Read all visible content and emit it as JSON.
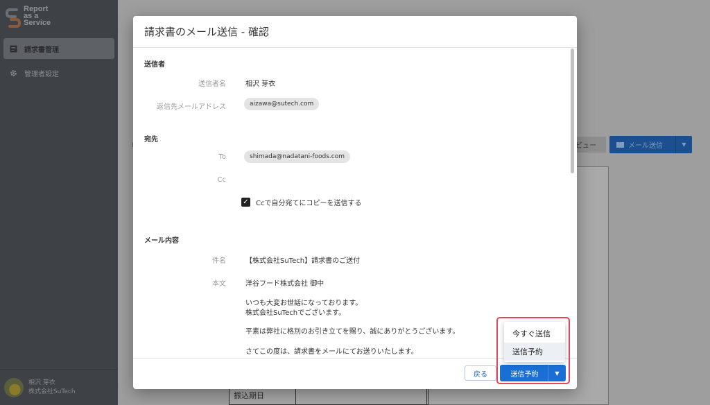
{
  "app": {
    "logo_lines": [
      "Report",
      "as a",
      "Service"
    ]
  },
  "sidebar": {
    "items": [
      {
        "label": "請求書管理",
        "icon": "document-icon",
        "active": true
      },
      {
        "label": "管理者設定",
        "icon": "gear-icon",
        "active": false
      }
    ],
    "user": {
      "name": "相沢 芽衣",
      "company": "株式会社SuTech"
    }
  },
  "background": {
    "preview_label": "ビュー",
    "send_label": "メール送信",
    "doc_cell": "振込期日"
  },
  "modal": {
    "title": "請求書のメール送信 - 確認",
    "sender": {
      "section": "送信者",
      "name_label": "送信者名",
      "name_value": "相沢 芽衣",
      "reply_label": "返信先メールアドレス",
      "reply_value": "aizawa@sutech.com"
    },
    "recipient": {
      "section": "宛先",
      "to_label": "To",
      "to_value": "shimada@nadatani-foods.com",
      "cc_label": "Cc",
      "cc_self_label": "Ccで自分宛てにコピーを送信する",
      "cc_self_checked": true
    },
    "content": {
      "section": "メール内容",
      "subject_label": "件名",
      "subject_value": "【株式会社SuTech】請求書のご送付",
      "body_label": "本文",
      "body_lines": [
        "洋谷フード株式会社 御中",
        "いつも大変お世話になっております。",
        "株式会社SuTechでございます。",
        "平素は弊社に格別のお引き立てを賜り、誠にありがとうございます。",
        "さてこの度は、請求書をメールにてお送りいたします。"
      ]
    },
    "footer": {
      "back_label": "戻る",
      "schedule_label": "送信予約"
    }
  },
  "dropdown": {
    "items": [
      "今すぐ送信",
      "送信予約"
    ],
    "highlighted": "送信予約"
  },
  "colors": {
    "primary": "#1a6fd6",
    "annotation": "#e0475e",
    "sidebar": "#3e4146"
  }
}
